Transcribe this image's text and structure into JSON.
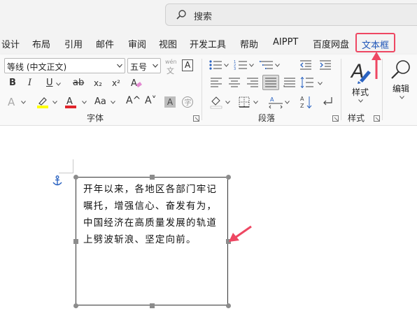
{
  "search": {
    "placeholder": "搜索"
  },
  "tabs": [
    "设计",
    "布局",
    "引用",
    "邮件",
    "审阅",
    "视图",
    "开发工具",
    "帮助",
    "AIPPT",
    "百度网盘",
    "文本框"
  ],
  "active_tab": "文本框",
  "font_group": {
    "font_name": "等线 (中文正文)",
    "font_size": "五号",
    "wen_label_top": "wén",
    "wen_label_bottom": "文",
    "bold": "B",
    "italic": "I",
    "underline": "U",
    "strike": "ab",
    "subscript": "x₂",
    "superscript": "x²",
    "aa": "Aa",
    "grow": "A^",
    "shrink": "A˅",
    "label": "字体",
    "highlight_color": "#ffff00",
    "font_color": "#e0242b"
  },
  "paragraph_group": {
    "label": "段落"
  },
  "styles_group": {
    "style_button": "样式",
    "label": "样式"
  },
  "edit_group": {
    "edit_button": "编辑"
  },
  "textbox": {
    "text": "开年以来，各地区各部门牢记嘱托，增强信心、奋发有为，中国经济在高质量发展的轨道上劈波斩浪、坚定向前。"
  },
  "annotation_color": "#ee4762"
}
